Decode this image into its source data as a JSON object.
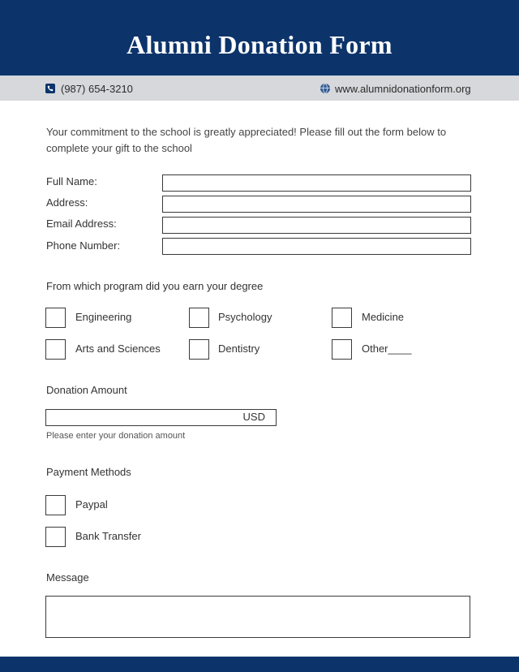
{
  "header": {
    "title": "Alumni Donation Form"
  },
  "contact": {
    "phone_icon": "phone-icon",
    "phone": "(987) 654-3210",
    "web_icon": "globe-icon",
    "website": "www.alumnidonationform.org"
  },
  "intro": "Your commitment to the school is greatly appreciated! Please fill out the form below to complete your gift to the school",
  "fields": [
    {
      "label": "Full Name:",
      "value": ""
    },
    {
      "label": "Address:",
      "value": ""
    },
    {
      "label": "Email Address:",
      "value": ""
    },
    {
      "label": "Phone Number:",
      "value": ""
    }
  ],
  "program": {
    "title": "From which program did you earn your degree",
    "options": [
      {
        "label": "Engineering",
        "checked": false
      },
      {
        "label": "Psychology",
        "checked": false
      },
      {
        "label": "Medicine",
        "checked": false
      },
      {
        "label": "Arts and Sciences",
        "checked": false
      },
      {
        "label": "Dentistry",
        "checked": false
      },
      {
        "label": "Other____",
        "checked": false
      }
    ]
  },
  "donation": {
    "title": "Donation Amount",
    "value": "",
    "currency": "USD",
    "hint": "Please enter your donation amount"
  },
  "payment": {
    "title": "Payment Methods",
    "options": [
      {
        "label": "Paypal",
        "checked": false
      },
      {
        "label": "Bank Transfer",
        "checked": false
      }
    ]
  },
  "message": {
    "title": "Message",
    "value": ""
  },
  "colors": {
    "brand_navy": "#0c346b",
    "contact_bar": "#d7d8dc"
  }
}
